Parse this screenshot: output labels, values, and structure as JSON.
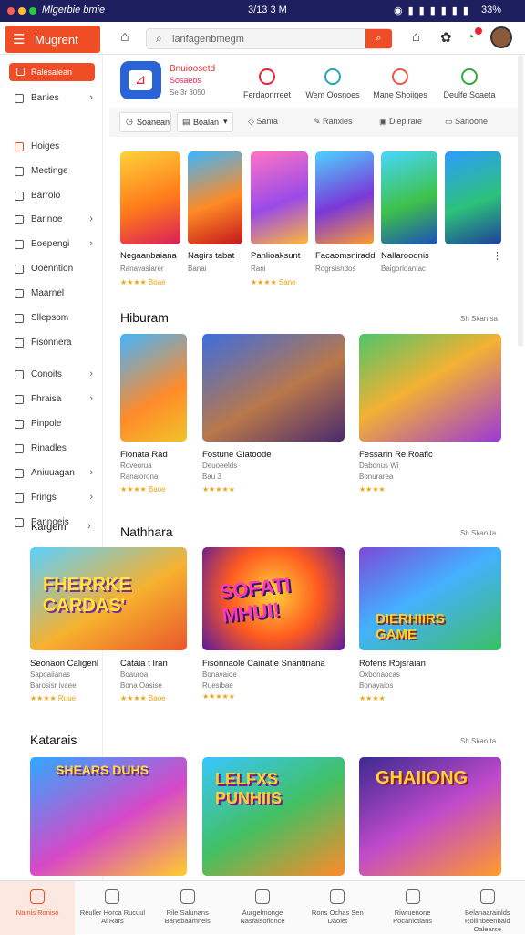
{
  "status": {
    "app_title": "Mlgerbie bmie",
    "time": "3/13 3 M",
    "battery": "33%"
  },
  "header": {
    "brand": "Mugrent",
    "search_placeholder": "lanfagenbmegm"
  },
  "sidebar": {
    "pinned": "Ralesalean",
    "items": [
      {
        "label": "Banies",
        "chevron": true
      },
      {
        "label": "Hoiges",
        "chevron": false
      },
      {
        "label": "Mectinge",
        "chevron": false
      },
      {
        "label": "Barrolo",
        "chevron": false
      },
      {
        "label": "Barinoe",
        "chevron": true
      },
      {
        "label": "Eoepengi",
        "chevron": true
      },
      {
        "label": "Ooenntion",
        "chevron": false
      },
      {
        "label": "Maarnel",
        "chevron": false
      },
      {
        "label": "Sllepsom",
        "chevron": false
      },
      {
        "label": "Fisonnera",
        "chevron": false
      },
      {
        "label": "Conoits",
        "chevron": true
      },
      {
        "label": "Fhraisa",
        "chevron": true
      },
      {
        "label": "Pinpole",
        "chevron": false
      },
      {
        "label": "Rinadles",
        "chevron": false
      },
      {
        "label": "Aniuuagan",
        "chevron": true
      },
      {
        "label": "Frings",
        "chevron": true
      },
      {
        "label": "Pannoeis",
        "chevron": false
      }
    ],
    "footer": "Kargem"
  },
  "featured": {
    "title": "Bnuioosetd",
    "subtitle": "Sosaeos",
    "meta": "Se 3r 3050"
  },
  "quick_actions": [
    "Ferdaonrreet",
    "Wem Oosnoes",
    "Mane Shoiiges",
    "Deulfe Soaeta"
  ],
  "filters": [
    "Soanean",
    "Boalan",
    "Santa",
    "Ranxies",
    "Diepirate",
    "Sanoone"
  ],
  "row1": [
    {
      "name": "Negaanbaiana",
      "sub": "Ranavasiarer",
      "rating": "★★★★ Boae"
    },
    {
      "name": "Nagirs tabat",
      "sub": "Banai",
      "rating": ""
    },
    {
      "name": "Panlioaksunt",
      "sub": "Rani",
      "rating": "★★★★ Sane"
    },
    {
      "name": "Facaomsniradd",
      "sub": "Rogrsisndos",
      "rating": ""
    },
    {
      "name": "Nallaroodnis",
      "sub": "Baigorloantac",
      "rating": ""
    }
  ],
  "sections": [
    {
      "title": "Hiburam",
      "more": "Sh Skan sa",
      "cards": [
        {
          "name": "Fionata Rad",
          "sub1": "Roveorua",
          "sub2": "Ranaiorona",
          "rating": "★★★★ Baoe"
        },
        {
          "name": "Fostune Giatoode",
          "sub1": "Deuoeelds",
          "sub2": "Bau 3",
          "rating": "★★★★★"
        },
        {
          "name": "Fessarin Re Roafic",
          "sub1": "Dabonus Wi",
          "sub2": "Bonurarea",
          "rating": "★★★★"
        }
      ]
    },
    {
      "title": "Nathhara",
      "more": "Sh Skan ta",
      "cards": [
        {
          "name": "Seonaon Caligenl",
          "sub1": "Sapoaiianas",
          "sub2": "Barosisr ivaee",
          "rating": "★★★★ Ruue"
        },
        {
          "name": "Cataia t Iran",
          "sub1": "Boauroa",
          "sub2": "Bona Oasise",
          "rating": "★★★★ Baoe"
        },
        {
          "name": "Fisonnaole Cainatie Snantinana",
          "sub1": "Bonavaioe",
          "sub2": "Ruesibae",
          "rating": "★★★★★"
        },
        {
          "name": "Rofens Rojsraian",
          "sub1": "Oxbonaocas",
          "sub2": "Bonayaios",
          "rating": "★★★★"
        }
      ]
    },
    {
      "title": "Katarais",
      "more": "Sh Skan ta"
    }
  ],
  "tile_art": {
    "row3": [
      "FHERRKE CARDAS'",
      "SOFATI MHUI!",
      "DIERHIIRS GAME"
    ],
    "row4": [
      "SHEARS DUHS",
      "LELFXS PUNHIIS",
      "GHAIIONG"
    ]
  },
  "bottom_nav": [
    {
      "label": "Namis Roniso",
      "active": true
    },
    {
      "label": "Reuller Horca Rucuul Ai Rars",
      "active": false
    },
    {
      "label": "Rile Salunans Banebaamnels",
      "active": false
    },
    {
      "label": "Aurgelmonge Nasfalsofionce",
      "active": false
    },
    {
      "label": "Rons Ochas Sen Daolet",
      "active": false
    },
    {
      "label": "Riwtuenone Pocanlotians",
      "active": false
    },
    {
      "label": "Belanaarainlds Roiilnbeenbaid Oalearse",
      "active": false
    }
  ],
  "colors": {
    "accent": "#ef4d25",
    "navy": "#1e1f5e",
    "star": "#f2a20c"
  }
}
